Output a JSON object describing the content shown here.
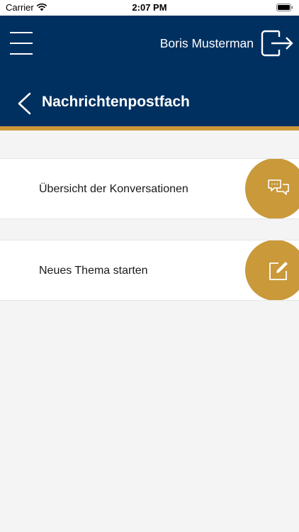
{
  "status_bar": {
    "carrier": "Carrier",
    "time": "2:07 PM",
    "icons": [
      "wifi-icon",
      "battery-icon"
    ]
  },
  "header": {
    "user_name": "Boris Musterman",
    "title": "Nachrichtenpostfach",
    "icons": [
      "menu-icon",
      "logout-icon",
      "back-chevron-icon"
    ]
  },
  "menu_items": [
    {
      "label": "Übersicht der Konversationen",
      "icon": "chat-bubbles-icon"
    },
    {
      "label": "Neues Thema starten",
      "icon": "edit-icon"
    }
  ],
  "colors": {
    "header_bg": "#003060",
    "accent": "#c9993a",
    "page_bg": "#f4f4f4",
    "card_bg": "#ffffff"
  }
}
